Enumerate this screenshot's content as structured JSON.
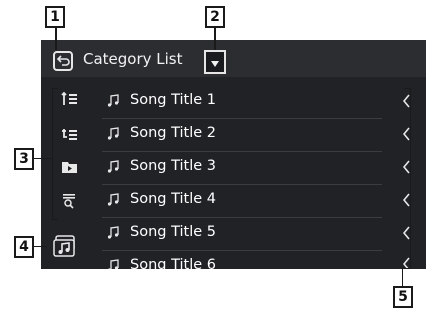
{
  "header": {
    "title": "Category List"
  },
  "list": {
    "items": [
      {
        "label": "Song Title 1"
      },
      {
        "label": "Song Title 2"
      },
      {
        "label": "Song Title 3"
      },
      {
        "label": "Song Title 4"
      },
      {
        "label": "Song Title 5"
      },
      {
        "label": "Song Title 6"
      }
    ]
  },
  "callouts": {
    "c1": "1",
    "c2": "2",
    "c3": "3",
    "c4": "4",
    "c5": "5"
  },
  "icons": {
    "back": "back-arrow-icon",
    "dropdown": "triangle-down-icon",
    "sort_asc": "sort-list-icon",
    "sort_title": "sort-title-icon",
    "folder": "folder-play-icon",
    "search": "search-list-icon",
    "media_mode": "music-mode-icon",
    "row": "music-note-icon",
    "scroll": "chevron-left-icon"
  },
  "colors": {
    "screen_bg": "#202226",
    "header_bg": "#2b2d31",
    "text": "#ffffff"
  }
}
